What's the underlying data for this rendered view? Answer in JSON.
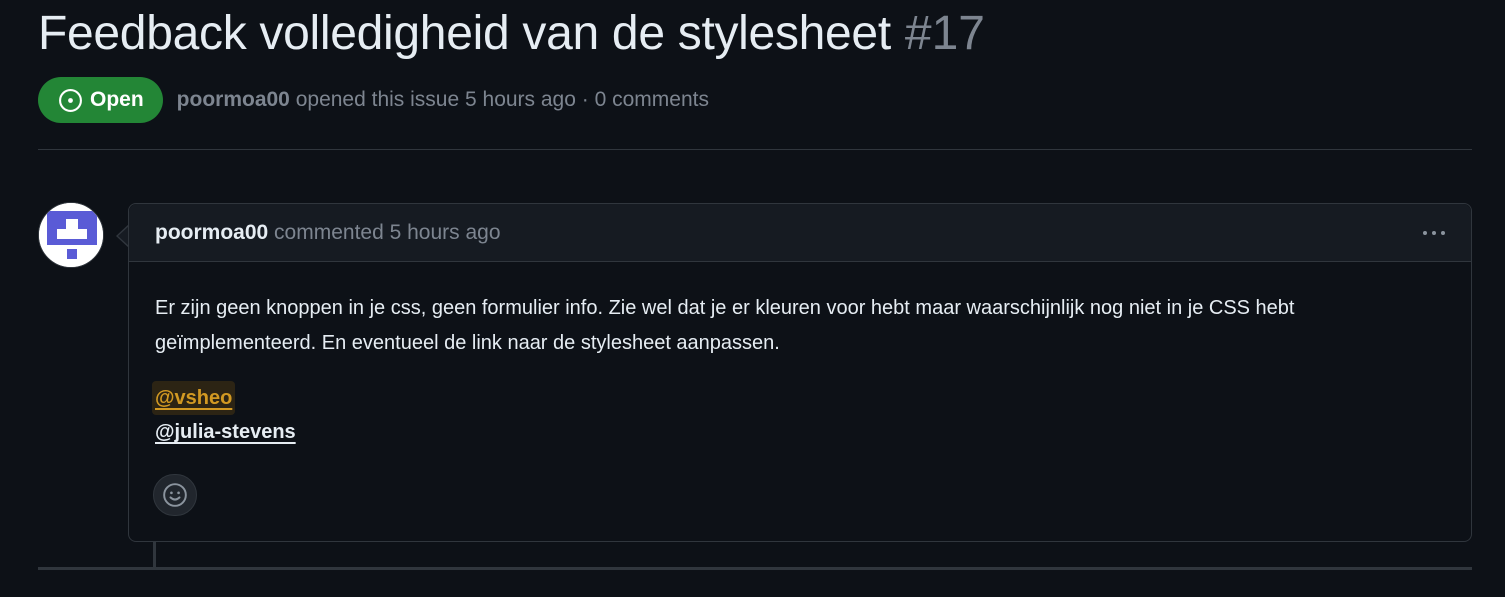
{
  "issue": {
    "title": "Feedback volledigheid van de stylesheet",
    "number": "#17",
    "state": "Open",
    "author": "poormoa00",
    "meta": "opened this issue 5 hours ago · 0 comments"
  },
  "comment": {
    "author": "poormoa00",
    "action": "commented 5 hours ago",
    "body": "Er zijn geen knoppen in je css, geen formulier info. Zie wel dat je er kleuren voor hebt maar waarschijnlijk nog niet in je CSS hebt geïmplementeerd. En eventueel de link naar de stylesheet aanpassen.",
    "mentions": [
      "@vsheo",
      "@julia-stevens"
    ]
  },
  "icons": {
    "state": "issue-opened-icon",
    "menu": "kebab-horizontal-icon",
    "reaction": "smiley-icon",
    "avatar": "identicon-avatar"
  },
  "colors": {
    "background": "#0d1117",
    "open_badge": "#238636",
    "mention_highlight": "#d29922",
    "border": "#30363d"
  }
}
